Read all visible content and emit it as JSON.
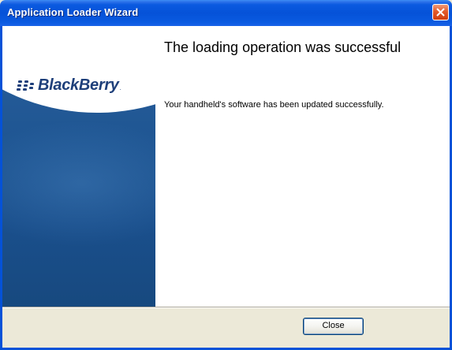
{
  "window": {
    "title": "Application Loader Wizard",
    "close_icon": "close-icon"
  },
  "branding": {
    "logo_text": "BlackBerry",
    "logo_trademark": ".",
    "logo_icon": "blackberry-logo-icon",
    "brand_color": "#1e3f7a"
  },
  "main": {
    "heading": "The loading operation was successful",
    "message": "Your handheld's software has been updated successfully."
  },
  "footer": {
    "close_label": "Close"
  },
  "colors": {
    "titlebar": "#0552d8",
    "dialog_background": "#ece9d8",
    "side_panel": "#1f5693"
  }
}
